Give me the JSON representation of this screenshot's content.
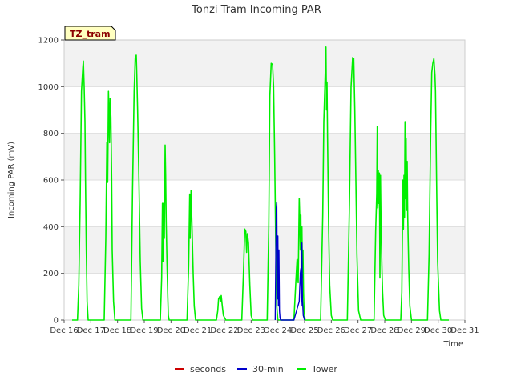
{
  "chart_data": {
    "type": "line",
    "title": "Tonzi Tram Incoming PAR",
    "xlabel": "Time",
    "ylabel": "Incoming PAR (mV)",
    "ylim": [
      0,
      1200
    ],
    "xlim": [
      16,
      31
    ],
    "yticks": [
      0,
      200,
      400,
      600,
      800,
      1000,
      1200
    ],
    "xticks": [
      {
        "value": 16,
        "label": "Dec 16"
      },
      {
        "value": 17,
        "label": "Dec 17"
      },
      {
        "value": 18,
        "label": "Dec 18"
      },
      {
        "value": 19,
        "label": "Dec 19"
      },
      {
        "value": 20,
        "label": "Dec 20"
      },
      {
        "value": 21,
        "label": "Dec 21"
      },
      {
        "value": 22,
        "label": "Dec 22"
      },
      {
        "value": 23,
        "label": "Dec 23"
      },
      {
        "value": 24,
        "label": "Dec 24"
      },
      {
        "value": 25,
        "label": "Dec 25"
      },
      {
        "value": 26,
        "label": "Dec 26"
      },
      {
        "value": 27,
        "label": "Dec 27"
      },
      {
        "value": 28,
        "label": "Dec 28"
      },
      {
        "value": 29,
        "label": "Dec 29"
      },
      {
        "value": 30,
        "label": "Dec 30"
      },
      {
        "value": 31,
        "label": "Dec 31"
      }
    ],
    "tag_label": "TZ_tram",
    "grid": "horizontal bands",
    "legend_position": "bottom",
    "series": [
      {
        "name": "seconds",
        "color": "#cc0000",
        "x": [],
        "y": []
      },
      {
        "name": "30-min",
        "color": "#0000cc",
        "x": [
          23.9,
          23.94,
          23.96,
          23.98,
          24.0,
          24.02,
          24.04,
          24.06,
          24.08,
          24.1,
          24.6,
          24.65,
          24.7,
          24.75,
          24.8,
          24.84,
          24.86,
          24.88,
          24.9,
          24.92,
          24.95,
          25.0
        ],
        "y": [
          0,
          480,
          505,
          90,
          360,
          60,
          300,
          40,
          10,
          0,
          0,
          20,
          40,
          60,
          80,
          200,
          220,
          60,
          330,
          90,
          20,
          0
        ]
      },
      {
        "name": "Tower",
        "color": "#00ee00",
        "x": [
          16.3,
          16.5,
          16.55,
          16.6,
          16.65,
          16.7,
          16.72,
          16.75,
          16.78,
          16.8,
          16.83,
          16.86,
          16.9,
          16.95,
          17.05,
          17.5,
          17.56,
          17.6,
          17.63,
          17.66,
          17.7,
          17.72,
          17.75,
          17.78,
          17.8,
          17.85,
          17.9,
          17.95,
          18.05,
          18.5,
          18.56,
          18.62,
          18.66,
          18.7,
          18.72,
          18.75,
          18.8,
          18.85,
          18.9,
          18.95,
          19.05,
          19.6,
          19.65,
          19.68,
          19.7,
          19.72,
          19.75,
          19.78,
          19.8,
          19.82,
          19.85,
          19.88,
          19.9,
          19.93,
          19.97,
          20.05,
          20.6,
          20.66,
          20.7,
          20.72,
          20.75,
          20.78,
          20.8,
          20.83,
          20.87,
          20.92,
          21.0,
          21.7,
          21.75,
          21.78,
          21.82,
          21.85,
          21.88,
          21.92,
          21.96,
          22.05,
          22.65,
          22.72,
          22.76,
          22.8,
          22.83,
          22.86,
          22.9,
          22.95,
          23.0,
          23.05,
          23.1,
          23.6,
          23.66,
          23.7,
          23.75,
          23.8,
          23.84,
          23.88,
          23.92,
          23.96,
          24.0,
          24.05,
          24.1,
          24.6,
          24.68,
          24.72,
          24.76,
          24.8,
          24.82,
          24.84,
          24.86,
          24.88,
          24.9,
          24.92,
          24.94,
          24.96,
          24.98,
          25.02,
          25.1,
          25.6,
          25.68,
          25.72,
          25.76,
          25.8,
          25.82,
          25.84,
          25.86,
          25.88,
          25.9,
          25.94,
          26.0,
          26.05,
          26.1,
          26.6,
          26.68,
          26.74,
          26.8,
          26.84,
          26.88,
          26.92,
          26.96,
          27.02,
          27.1,
          27.6,
          27.66,
          27.7,
          27.72,
          27.74,
          27.76,
          27.78,
          27.8,
          27.82,
          27.84,
          27.86,
          27.88,
          27.9,
          27.92,
          27.96,
          28.02,
          28.1,
          28.6,
          28.64,
          28.68,
          28.7,
          28.72,
          28.74,
          28.76,
          28.78,
          28.8,
          28.82,
          28.84,
          28.86,
          28.88,
          28.9,
          28.94,
          29.0,
          29.1,
          29.6,
          29.66,
          29.72,
          29.76,
          29.8,
          29.84,
          29.88,
          29.9,
          29.94,
          29.98,
          30.05,
          30.1,
          30.4
        ],
        "y": [
          0,
          0,
          150,
          500,
          980,
          1080,
          1110,
          1000,
          850,
          600,
          300,
          80,
          0,
          0,
          0,
          0,
          350,
          760,
          590,
          980,
          760,
          950,
          870,
          600,
          300,
          80,
          0,
          0,
          0,
          0,
          550,
          980,
          1120,
          1135,
          1050,
          900,
          600,
          250,
          50,
          0,
          0,
          0,
          180,
          500,
          250,
          500,
          350,
          750,
          620,
          420,
          250,
          100,
          20,
          0,
          0,
          0,
          0,
          230,
          540,
          350,
          555,
          430,
          340,
          200,
          60,
          0,
          0,
          0,
          40,
          90,
          100,
          80,
          105,
          60,
          20,
          0,
          0,
          230,
          390,
          380,
          290,
          370,
          330,
          150,
          20,
          0,
          0,
          0,
          400,
          960,
          1100,
          1095,
          1000,
          700,
          330,
          60,
          0,
          0,
          0,
          0,
          180,
          260,
          160,
          520,
          440,
          300,
          450,
          200,
          400,
          180,
          300,
          120,
          40,
          0,
          0,
          0,
          450,
          850,
          1000,
          1170,
          900,
          1020,
          780,
          600,
          400,
          150,
          20,
          0,
          0,
          0,
          500,
          1000,
          1125,
          1120,
          900,
          600,
          280,
          40,
          0,
          0,
          380,
          540,
          830,
          480,
          640,
          500,
          630,
          180,
          620,
          420,
          300,
          200,
          120,
          20,
          0,
          0,
          0,
          120,
          600,
          390,
          620,
          440,
          850,
          520,
          780,
          470,
          680,
          450,
          330,
          220,
          60,
          0,
          0,
          0,
          280,
          800,
          1060,
          1100,
          1120,
          1050,
          980,
          600,
          250,
          40,
          0,
          0
        ]
      }
    ]
  }
}
